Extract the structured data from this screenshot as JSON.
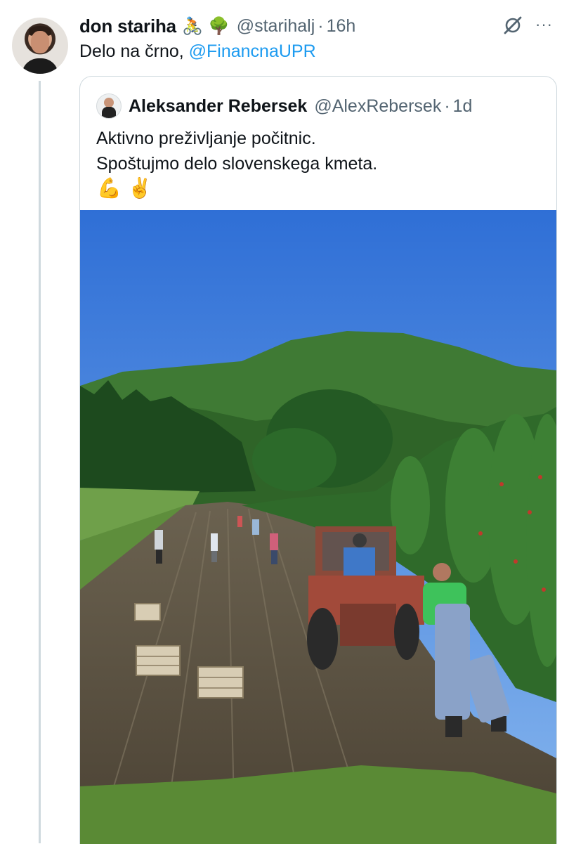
{
  "tweet": {
    "author_name": "don stariha",
    "emojis": [
      "🚴",
      "🌳"
    ],
    "handle": "@starihalj",
    "separator": "·",
    "time": "16h",
    "text": "Delo na črno, ",
    "mention": "@FinancnaUPR"
  },
  "icons": {
    "grok": "grok-icon",
    "more": "more-icon",
    "more_glyph": "···"
  },
  "quoted_tweet": {
    "author_name": "Aleksander Rebersek",
    "handle": "@AlexRebersek",
    "separator": "·",
    "time": "1d",
    "lines": [
      "Aktivno preživljanje počitnic.",
      "Spoštujmo delo slovenskega kmeta."
    ],
    "emojis": "💪 ✌️"
  },
  "colors": {
    "accent": "#1d9bf0",
    "secondary_text": "#536471",
    "border": "#cfd9de"
  }
}
